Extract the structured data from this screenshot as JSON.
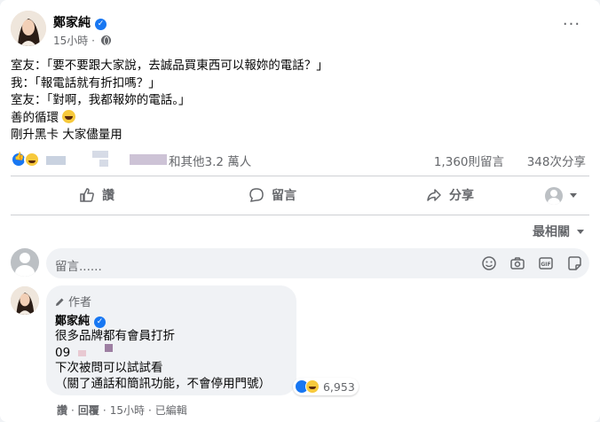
{
  "post": {
    "author": "鄭家純",
    "time": "15小時",
    "more": "···",
    "lines": [
      "室友：「要不要跟大家說，去誠品買東西可以報妳的電話？」",
      "我：「報電話就有折扣嗎？」",
      "室友：「對啊，我都報妳的電話。」",
      "善的循環",
      "剛升黑卡 大家儘量用"
    ]
  },
  "reactions": {
    "others_text": "和其他3.2 萬人",
    "comments": "1,360則留言",
    "shares": "348次分享"
  },
  "actions": {
    "like": "讚",
    "comment": "留言",
    "share": "分享"
  },
  "sort": {
    "label": "最相關"
  },
  "composer": {
    "placeholder": "留言......"
  },
  "comment": {
    "badge": "作者",
    "name": "鄭家純",
    "line1": "很多品牌都有會員打折",
    "line2_prefix": "09",
    "line3": "下次被問可以試試看",
    "line4": "（關了通話和簡訊功能，不會停用門號）",
    "reaction_count": "6,953",
    "like": "讚",
    "reply": "回覆",
    "time": "15小時",
    "edited": "已編輯",
    "sep": "·"
  },
  "colors": {
    "accent": "#1877f2",
    "muted": "#65676b",
    "bubble": "#f0f2f5",
    "haha": "#f7c93c"
  }
}
